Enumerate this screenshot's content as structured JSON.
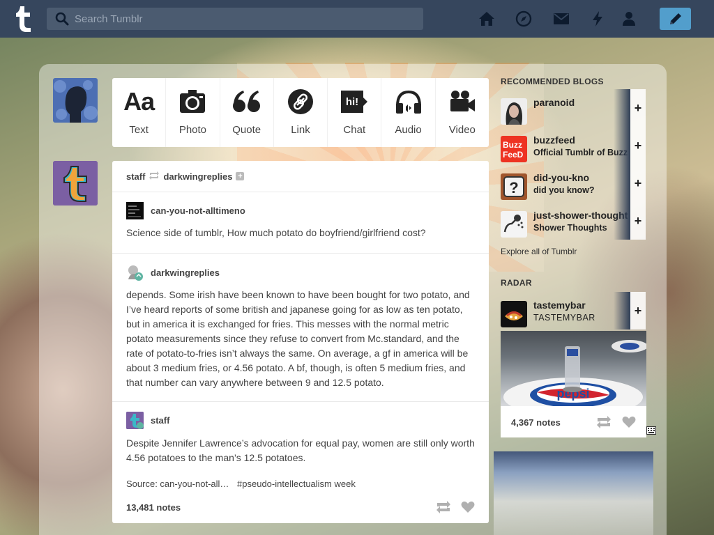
{
  "header": {
    "search_placeholder": "Search Tumblr",
    "accent": "#36465d",
    "compose_color": "#529ecc"
  },
  "post_types": [
    {
      "label": "Text",
      "icon": "text-icon"
    },
    {
      "label": "Photo",
      "icon": "camera-icon"
    },
    {
      "label": "Quote",
      "icon": "quote-icon"
    },
    {
      "label": "Link",
      "icon": "link-icon"
    },
    {
      "label": "Chat",
      "icon": "chat-icon"
    },
    {
      "label": "Audio",
      "icon": "headphones-icon"
    },
    {
      "label": "Video",
      "icon": "video-camera-icon"
    }
  ],
  "post": {
    "author": "staff",
    "reblogged_from": "darkwingreplies",
    "reblogs": [
      {
        "user": "can-you-not-alltimeno",
        "text": "Science side of tumblr, How much potato do boyfriend/girlfriend cost?"
      },
      {
        "user": "darkwingreplies",
        "text": "depends. Some irish have been known to have been bought for two potato, and I’ve heard reports of some british and japanese going for as low as ten potato, but in america it is exchanged for fries. This messes with the normal metric potato measurements since they refuse to convert from Mc.standard, and the rate of potato-to-fries isn’t always the same. On average, a gf in america will be about 3 medium fries, or 4.56 potato. A bf, though, is often 5 medium fries, and that number can vary anywhere between 9 and 12.5 potato."
      },
      {
        "user": "staff",
        "text": "Despite Jennifer Lawrence’s advocation for equal pay, women are still only worth 4.56 potatoes to the man’s 12.5 potatoes."
      }
    ],
    "source": "Source: can-you-not-all…",
    "tag": "#pseudo-intellectualism week",
    "notes": "13,481 notes"
  },
  "sidebar": {
    "recommended_title": "RECOMMENDED BLOGS",
    "recommended": [
      {
        "name": "paranoid",
        "desc": ""
      },
      {
        "name": "buzzfeed",
        "desc": "Official Tumblr of BuzzFeed"
      },
      {
        "name": "did-you-kno",
        "desc": "did you know?"
      },
      {
        "name": "just-shower-thoughts",
        "desc": "Shower Thoughts"
      }
    ],
    "explore": "Explore all of Tumblr",
    "radar_title": "RADAR",
    "radar": {
      "name": "tastemybar",
      "desc": "TASTEMYBAR",
      "notes": "4,367 notes",
      "image_text": "pepsi"
    }
  }
}
